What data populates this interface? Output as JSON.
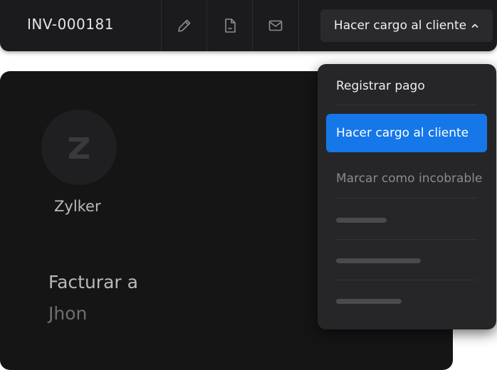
{
  "header": {
    "invoice_number": "INV-000181",
    "toolbar": {
      "edit_icon": "pencil-icon",
      "pdf_icon": "document-icon",
      "email_icon": "envelope-icon"
    },
    "action_button_label": "Hacer cargo al cliente",
    "action_button_icon": "chevron-up-icon"
  },
  "invoice": {
    "logo_letter": "Z",
    "company_name": "Zylker",
    "bill_to_label": "Facturar a",
    "bill_to_name": "Jhon"
  },
  "dropdown": {
    "items": [
      {
        "label": "Registrar pago",
        "state": "normal"
      },
      {
        "label": "Hacer cargo al cliente",
        "state": "selected"
      },
      {
        "label": "Marcar como incobrable",
        "state": "disabled"
      }
    ],
    "placeholder_items": 3
  },
  "colors": {
    "accent": "#1577e8",
    "background": "#151516",
    "menu_background": "#262628"
  }
}
